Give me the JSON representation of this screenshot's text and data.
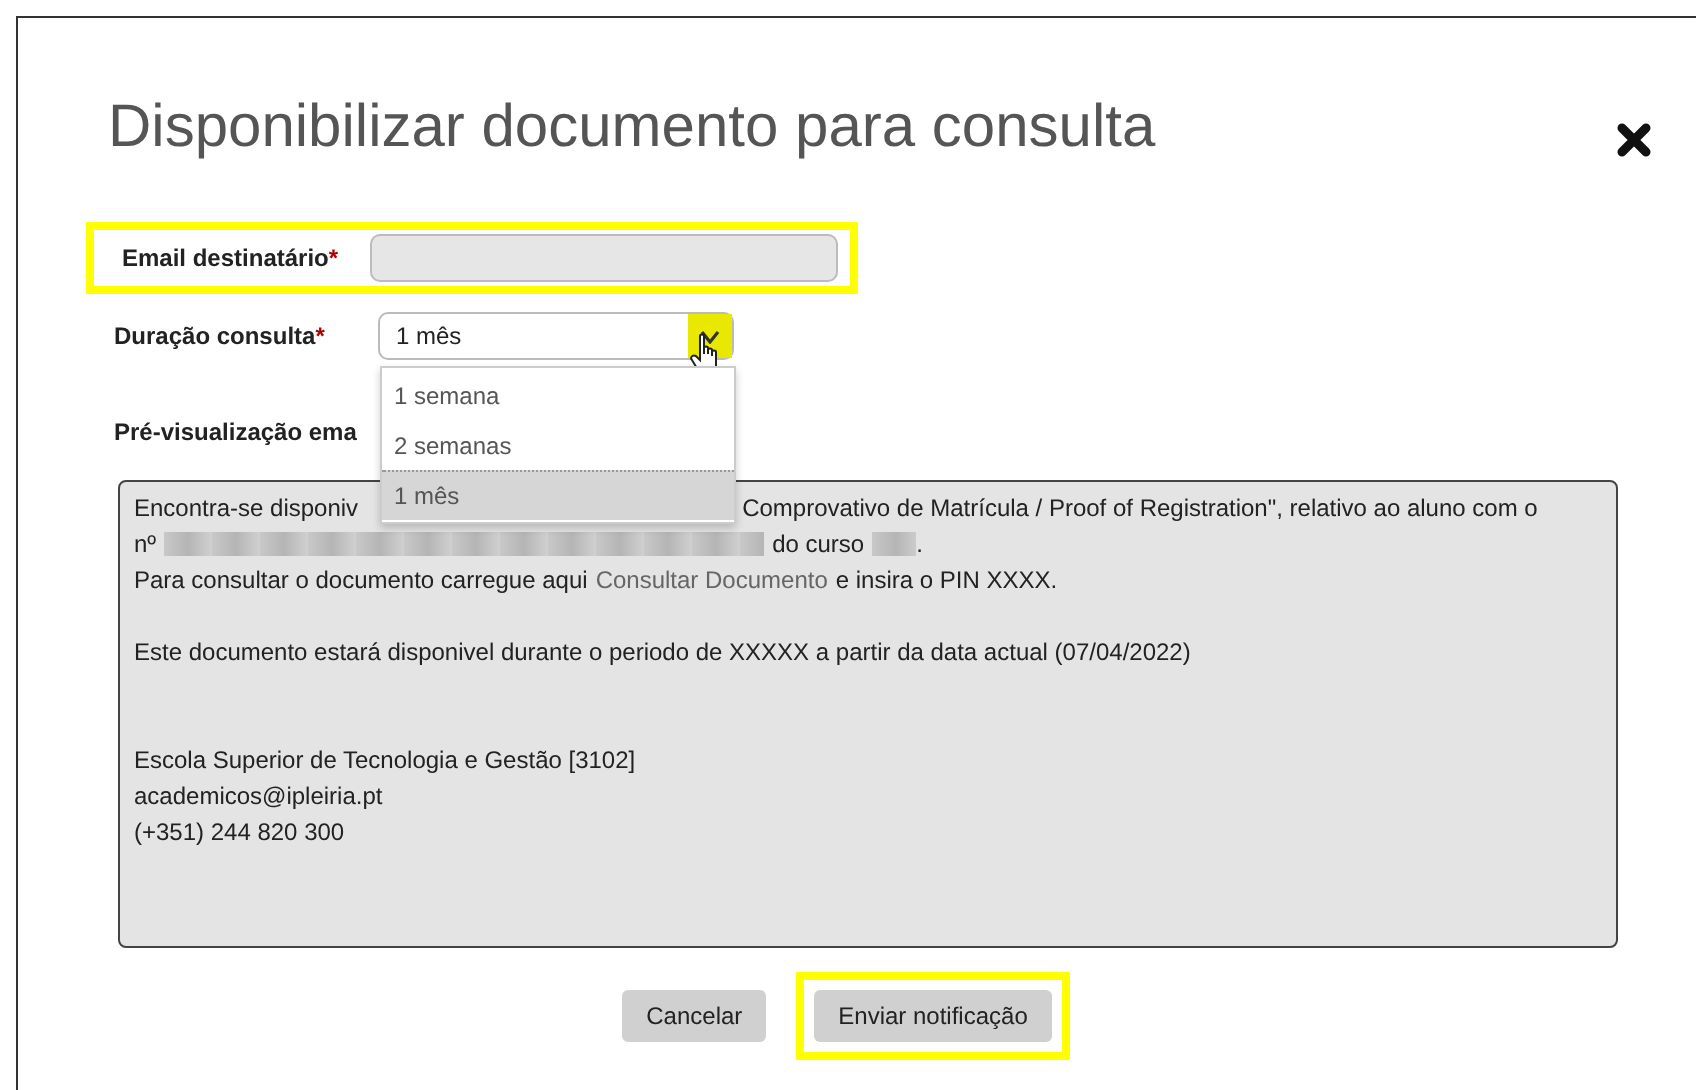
{
  "dialog": {
    "title": "Disponibilizar documento para consulta"
  },
  "email_field": {
    "label": "Email destinatário",
    "required_mark": "*",
    "highlighted": true
  },
  "duration_field": {
    "label": "Duração consulta",
    "required_mark": "*",
    "value": "1 mês",
    "open": true,
    "button_highlighted": true,
    "options": [
      {
        "label": "1 semana",
        "selected": false
      },
      {
        "label": "2 semanas",
        "selected": false
      },
      {
        "label": "1 mês",
        "selected": true
      }
    ]
  },
  "preview": {
    "label": "Pré-visualização ema",
    "paragraphs": [
      {
        "lines": [
          [
            {
              "kind": "text",
              "text": "Encontra-se disponiv"
            },
            {
              "kind": "covered"
            },
            {
              "kind": "text",
              "text": "Comprovativo de Matrícula / Proof of Registration\", relativo ao aluno com o"
            }
          ],
          [
            {
              "kind": "text",
              "text": "nº"
            },
            {
              "kind": "redacted"
            },
            {
              "kind": "text",
              "text": "do curso"
            },
            {
              "kind": "redacted"
            },
            {
              "kind": "text",
              "text": "."
            }
          ],
          [
            {
              "kind": "text",
              "text": "Para consultar o documento carregue aqui"
            },
            {
              "kind": "link",
              "text": "Consultar Documento"
            },
            {
              "kind": "text",
              "text": "e insira o PIN XXXX."
            }
          ]
        ]
      },
      {
        "lines": [
          [
            {
              "kind": "text",
              "text": "Este documento estará disponivel durante o periodo de XXXXX a partir da data actual (07/04/2022)"
            }
          ]
        ]
      },
      {
        "lines": [
          [
            {
              "kind": "text",
              "text": "Escola Superior de Tecnologia e Gestão [3102]"
            }
          ],
          [
            {
              "kind": "text",
              "text": "academicos@ipleiria.pt"
            }
          ],
          [
            {
              "kind": "text",
              "text": "(+351) 244 820 300"
            }
          ]
        ]
      }
    ]
  },
  "buttons": [
    {
      "label": "Cancelar",
      "highlighted": false
    },
    {
      "label": "Enviar notificação",
      "highlighted": true
    }
  ]
}
